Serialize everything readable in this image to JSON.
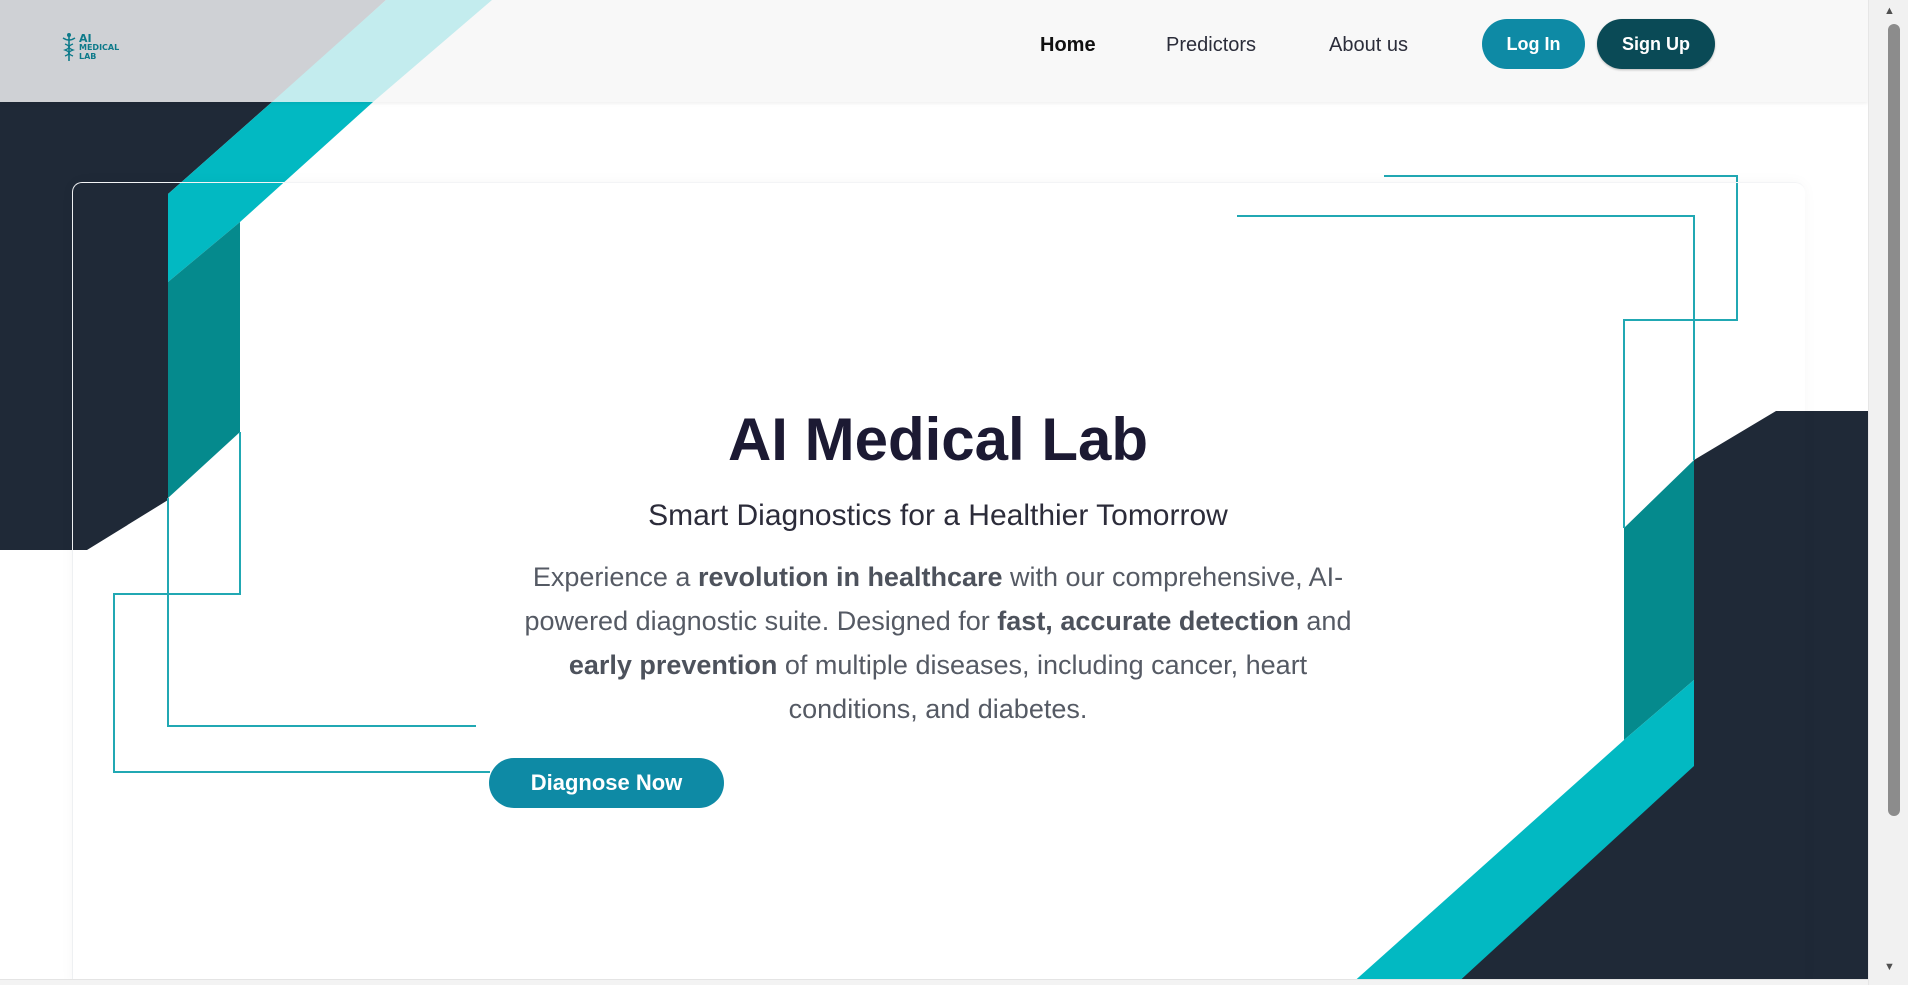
{
  "colors": {
    "navy": "#1f2937",
    "teal": "#02b9c2",
    "teal_dark": "#058a8d",
    "accent": "#0e8aa5",
    "signup": "#0a4a56",
    "title": "#1c1a33"
  },
  "logo": {
    "icon": "caduceus-icon",
    "line1": "AI",
    "line2": "MEDICAL",
    "line3": "LAB"
  },
  "nav": {
    "items": [
      {
        "label": "Home",
        "active": true
      },
      {
        "label": "Predictors",
        "active": false
      },
      {
        "label": "About us",
        "active": false
      }
    ],
    "login_label": "Log In",
    "signup_label": "Sign Up"
  },
  "hero": {
    "title": "AI Medical Lab",
    "subtitle": "Smart Diagnostics for a Healthier Tomorrow",
    "description": [
      {
        "text": "Experience a ",
        "bold": false
      },
      {
        "text": "revolution in healthcare",
        "bold": true
      },
      {
        "text": " with our comprehensive, AI-powered diagnostic suite. Designed for ",
        "bold": false
      },
      {
        "text": "fast, accurate detection",
        "bold": true
      },
      {
        "text": " and ",
        "bold": false
      },
      {
        "text": "early prevention",
        "bold": true
      },
      {
        "text": " of multiple diseases, including cancer, heart conditions, and diabetes.",
        "bold": false
      }
    ],
    "cta_label": "Diagnose Now"
  },
  "scrollbar": {
    "up_icon": "arrow-up-icon",
    "down_icon": "arrow-down-icon"
  }
}
